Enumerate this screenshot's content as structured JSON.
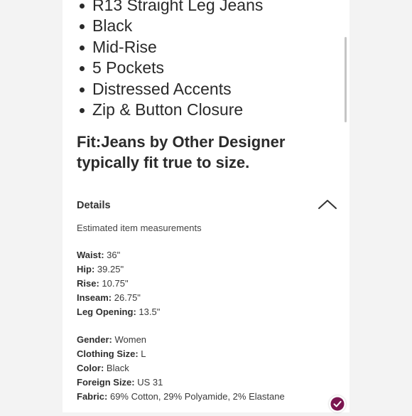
{
  "bullets": [
    "R13 Straight Leg Jeans",
    "Black",
    "Mid-Rise",
    "5 Pockets",
    "Distressed Accents",
    "Zip & Button Closure"
  ],
  "fit": {
    "line1": "Fit:Jeans by Other Designer",
    "line2": "typically fit true to size."
  },
  "details": {
    "title": "Details",
    "subtitle": "Estimated item measurements",
    "chevron_icon": "chevron-up-icon",
    "measurements": [
      {
        "label": "Waist:",
        "value": "36\""
      },
      {
        "label": "Hip:",
        "value": "39.25\""
      },
      {
        "label": "Rise:",
        "value": "10.75\""
      },
      {
        "label": "Inseam:",
        "value": "26.75\""
      },
      {
        "label": "Leg Opening:",
        "value": "13.5\""
      }
    ],
    "attributes": [
      {
        "label": "Gender:",
        "value": "Women"
      },
      {
        "label": "Clothing Size:",
        "value": "L"
      },
      {
        "label": "Color:",
        "value": "Black"
      },
      {
        "label": "Foreign Size:",
        "value": "US 31"
      },
      {
        "label": "Fabric:",
        "value": "69% Cotton, 29% Polyamide, 2% Elastane"
      }
    ]
  },
  "badge": {
    "icon": "checkmark-badge-icon",
    "color": "#7b1650"
  }
}
